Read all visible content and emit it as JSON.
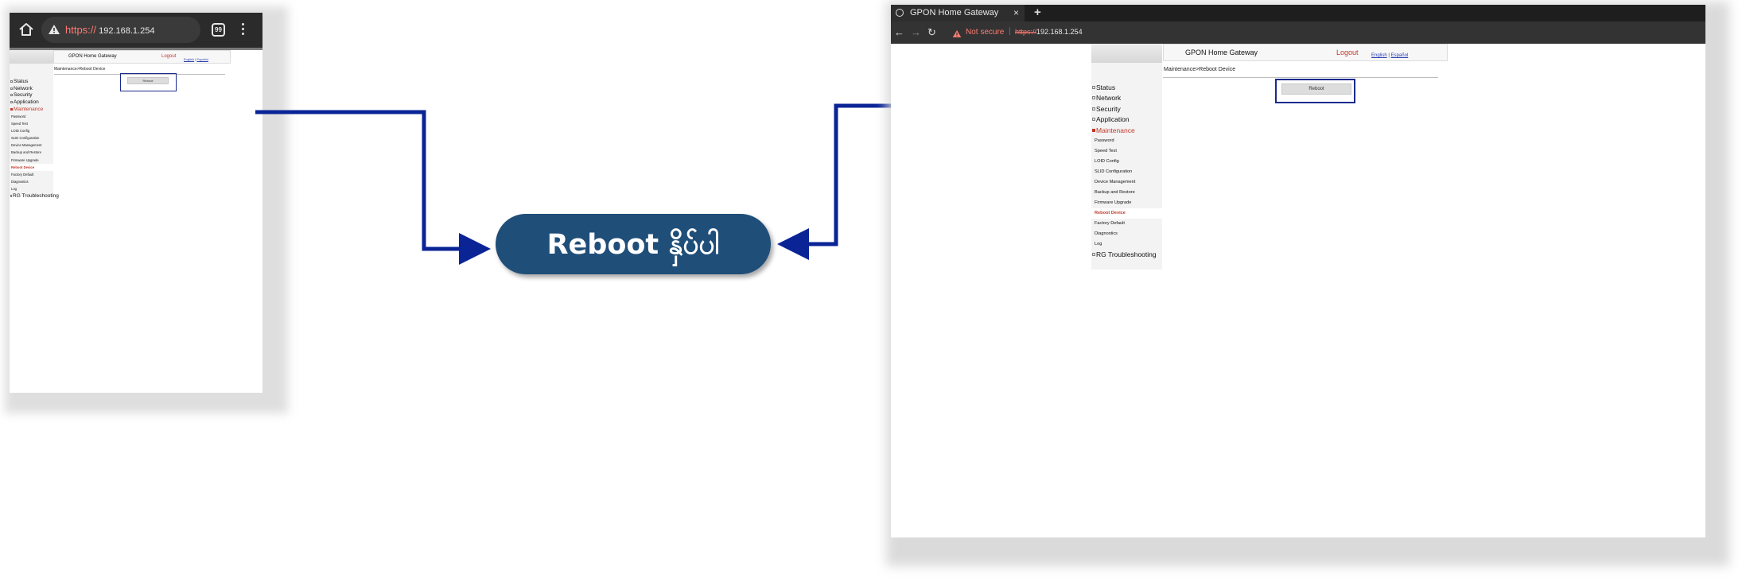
{
  "mobile": {
    "url_scheme": "https://",
    "url_host": "192.168.1.254",
    "tab_count": "99"
  },
  "desktop": {
    "tab_title": "GPON Home Gateway",
    "tab_close": "×",
    "new_tab": "+",
    "not_secure": "Not secure",
    "url_scheme": "https://",
    "url_host": "192.168.1.254"
  },
  "router": {
    "title": "GPON Home Gateway",
    "logout": "Logout",
    "lang_english": "English",
    "lang_sep": "|",
    "lang_espanol": "Español",
    "breadcrumb": "Maintenance>Reboot Device",
    "reboot_button": "Reboot",
    "menu": [
      {
        "label": "Status",
        "bullet": true,
        "level": 1
      },
      {
        "label": "Network",
        "bullet": true,
        "level": 1
      },
      {
        "label": "Security",
        "bullet": true,
        "level": 1
      },
      {
        "label": "Application",
        "bullet": true,
        "level": 1
      },
      {
        "label": "Maintenance",
        "bullet": true,
        "level": 1,
        "active": true
      },
      {
        "label": "Password",
        "level": 2
      },
      {
        "label": "Speed Test",
        "level": 2
      },
      {
        "label": "LOID Config",
        "level": 2
      },
      {
        "label": "SLID Configuration",
        "level": 2
      },
      {
        "label": "Device Management",
        "level": 2
      },
      {
        "label": "Backup and Restore",
        "level": 2
      },
      {
        "label": "Firmware Upgrade",
        "level": 2
      },
      {
        "label": "Reboot Device",
        "level": 2,
        "current": true
      },
      {
        "label": "Factory Default",
        "level": 2
      },
      {
        "label": "Diagnostics",
        "level": 2
      },
      {
        "label": "Log",
        "level": 2
      },
      {
        "label": "RG Troubleshooting",
        "bullet": true,
        "level": 1
      }
    ]
  },
  "callout": {
    "label": "Reboot နှိပ်ပါ",
    "accent": "#1f4e79",
    "arrow_color": "#0a2496"
  }
}
